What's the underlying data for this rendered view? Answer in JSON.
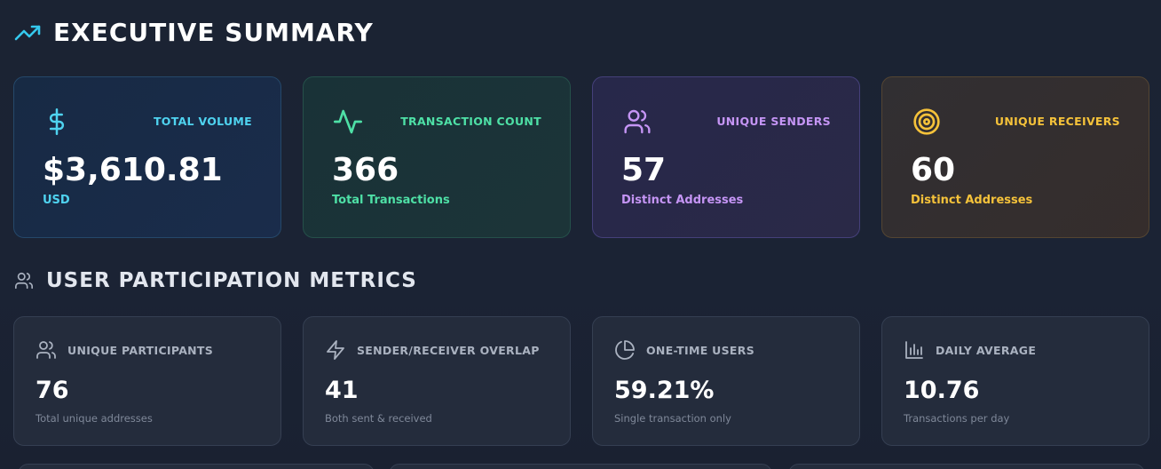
{
  "executive_summary": {
    "title": "EXECUTIVE SUMMARY",
    "icon": "trending-up-icon",
    "cards": [
      {
        "label": "TOTAL VOLUME",
        "value": "$3,610.81",
        "sub": "USD",
        "icon": "dollar-icon",
        "accent": "#4fd3f0"
      },
      {
        "label": "TRANSACTION COUNT",
        "value": "366",
        "sub": "Total Transactions",
        "icon": "activity-icon",
        "accent": "#4ee0a6"
      },
      {
        "label": "UNIQUE SENDERS",
        "value": "57",
        "sub": "Distinct Addresses",
        "icon": "users-icon",
        "accent": "#c595f5"
      },
      {
        "label": "UNIQUE RECEIVERS",
        "value": "60",
        "sub": "Distinct Addresses",
        "icon": "target-icon",
        "accent": "#f5c23a"
      }
    ]
  },
  "user_participation": {
    "title": "USER PARTICIPATION METRICS",
    "icon": "users-icon",
    "cards": [
      {
        "label": "UNIQUE PARTICIPANTS",
        "value": "76",
        "sub": "Total unique addresses",
        "icon": "users-icon"
      },
      {
        "label": "SENDER/RECEIVER OVERLAP",
        "value": "41",
        "sub": "Both sent & received",
        "icon": "zap-icon"
      },
      {
        "label": "ONE-TIME USERS",
        "value": "59.21%",
        "sub": "Single transaction only",
        "icon": "pie-chart-icon"
      },
      {
        "label": "DAILY AVERAGE",
        "value": "10.76",
        "sub": "Transactions per day",
        "icon": "bar-chart-icon"
      }
    ]
  }
}
